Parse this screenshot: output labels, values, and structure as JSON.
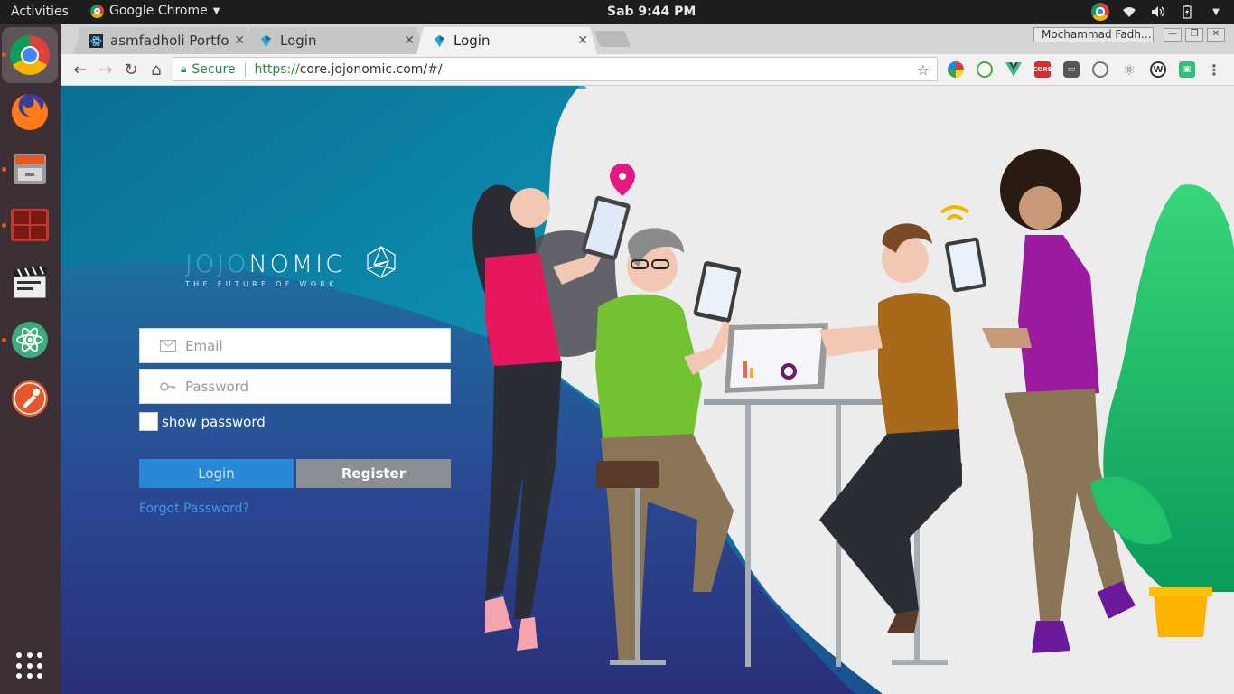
{
  "topbar": {
    "activities": "Activities",
    "app_name": "Google Chrome",
    "clock": "Sab  9:44 PM"
  },
  "dock": {
    "items": [
      "chrome",
      "firefox",
      "files",
      "terminal-tool",
      "video-editor",
      "atom",
      "postman"
    ]
  },
  "browser": {
    "tabs": [
      {
        "label": "asmfadholi Portfoli",
        "active": false
      },
      {
        "label": "Login",
        "active": false
      },
      {
        "label": "Login",
        "active": true
      }
    ],
    "profile": "Mochammad Fadh…",
    "omnibox": {
      "secure_label": "Secure",
      "url_scheme": "https://",
      "url_rest": "core.jojonomic.com/#/"
    }
  },
  "page": {
    "logo_word_a": "JOJO",
    "logo_word_b": "NOMIC",
    "logo_tagline": "THE FUTURE OF WORK",
    "email_placeholder": "Email",
    "password_placeholder": "Password",
    "show_password_label": "show password",
    "login_button": "Login",
    "register_button": "Register",
    "forgot_link": "Forgot Password?"
  },
  "colors": {
    "accent_blue": "#2a89d6",
    "register_gray": "#8a8e95",
    "bg_teal": "#0b8fb0",
    "bg_navy": "#263a8a",
    "ubuntu_orange": "#e95420"
  }
}
